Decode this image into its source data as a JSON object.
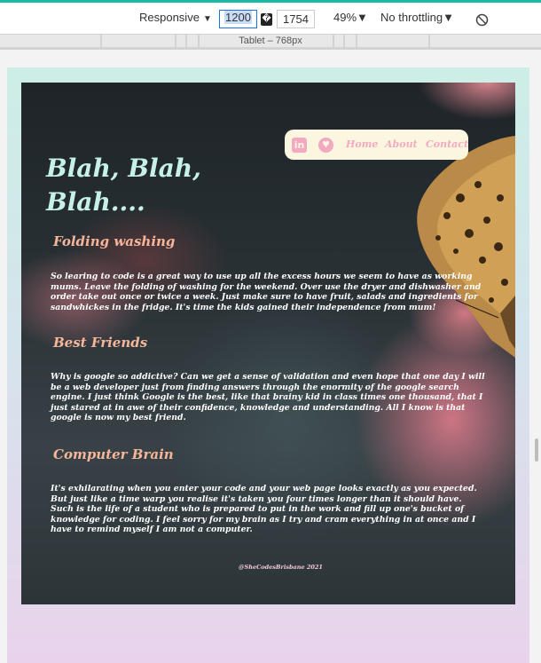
{
  "devtools": {
    "device": "Responsive",
    "width": "1200",
    "times_glyph": "�",
    "height": "1754",
    "zoom": "49%",
    "throttling": "No throttling",
    "breakpoint_label": "Tablet – 768px"
  },
  "site": {
    "nav": {
      "icons": [
        "linkedin-icon",
        "heart-icon"
      ],
      "links": [
        "Home",
        "About",
        "Contact"
      ]
    },
    "title": "Blah, Blah, Blah....",
    "sections": [
      {
        "heading": "Folding washing",
        "body": "So learing to code is a great way to use up all the excess hours we seem to have as working mums. Leave the folding of washing for the weekend. Over use the dryer and dishwasher and order take out once or twice a week. Just make sure to have fruit, salads and ingredients for sandwhickes in the fridge. It's time the kids gained their independence from mum!"
      },
      {
        "heading": "Best Friends",
        "body": "Why is google so addictive? Can we get a sense of validation and even hope that one day I will be a web developer just from finding answers through the enormity of the google search engine. I just think Google is the best, like that brainy kid in class times one thousand, that I just stared at in awe of their confidence, knowledge and understanding. All I know is that google is now my best friend."
      },
      {
        "heading": "Computer Brain",
        "body": "It's exhilarating when you enter your code and your web page looks exactly as you expected. But just like a time warp you realise it's taken you four times longer than it should have. Such is the life of a student who is prepared to put in the work and fill up one's bucket of knowledge for coding. I feel sorry for my brain as I try and cram everything in at once and I have to remind myself I am not a computer."
      }
    ],
    "footer": "@SheCodesBrisbane 2021"
  }
}
